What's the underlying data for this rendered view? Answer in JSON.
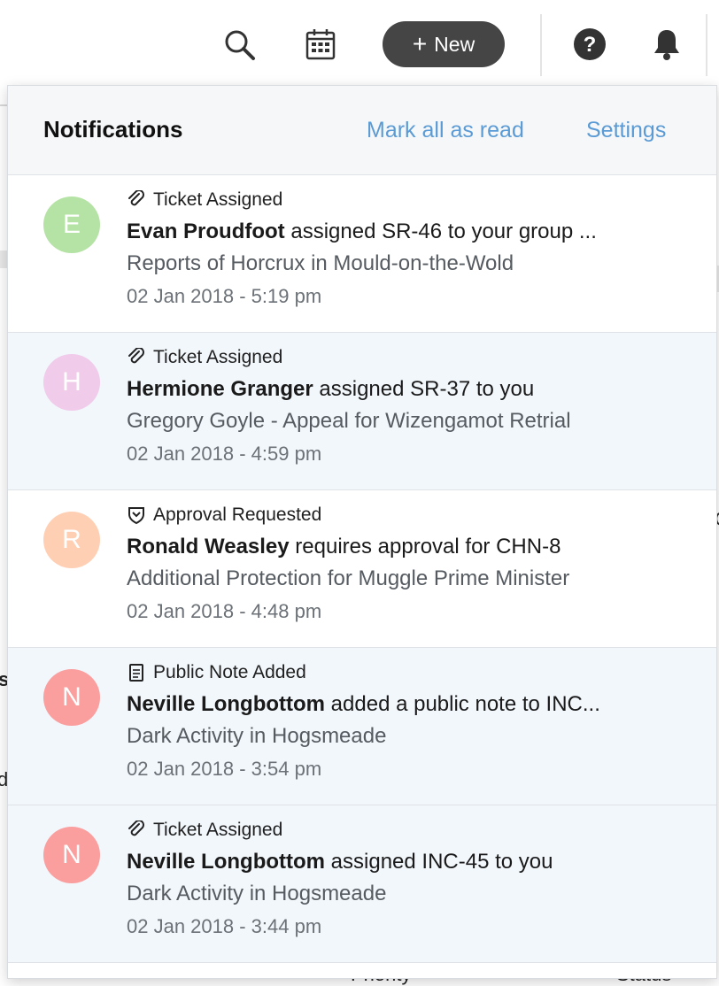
{
  "topbar": {
    "icons": [
      "search-icon",
      "calendar-icon",
      "help-icon",
      "bell-icon"
    ],
    "new_button_label": "New"
  },
  "background": {
    "frag_s": "s",
    "frag_d": "d",
    "frag_c": "C",
    "frag_priority": "Priority",
    "frag_status": "Status"
  },
  "panel": {
    "title": "Notifications",
    "mark_all_read": "Mark all as read",
    "settings": "Settings",
    "accent_link_color": "#5b9bd5"
  },
  "notifications": [
    {
      "type": "Ticket Assigned",
      "type_icon": "paperclip-icon",
      "avatar_letter": "E",
      "avatar_color": "#b5e3a5",
      "actor": "Evan Proudfoot",
      "action": "assigned SR-46 to your group ...",
      "subject": "Reports of Horcrux in Mould-on-the-Wold",
      "time": "02 Jan 2018 - 5:19 pm",
      "unread": false
    },
    {
      "type": "Ticket Assigned",
      "type_icon": "paperclip-icon",
      "avatar_letter": "H",
      "avatar_color": "#f0cbea",
      "actor": "Hermione Granger",
      "action": "assigned SR-37 to you",
      "subject": "Gregory Goyle - Appeal for Wizengamot Retrial",
      "time": "02 Jan 2018 - 4:59 pm",
      "unread": true
    },
    {
      "type": "Approval Requested",
      "type_icon": "approval-shield-icon",
      "avatar_letter": "R",
      "avatar_color": "#ffcfb4",
      "actor": "Ronald Weasley",
      "action": "requires approval for CHN-8",
      "subject": "Additional Protection for Muggle Prime Minister",
      "time": "02 Jan 2018 - 4:48 pm",
      "unread": false
    },
    {
      "type": "Public Note Added",
      "type_icon": "note-icon",
      "avatar_letter": "N",
      "avatar_color": "#fa9e9e",
      "actor": "Neville Longbottom",
      "action": "added a public note to INC...",
      "subject": "Dark Activity in Hogsmeade",
      "time": "02 Jan 2018 - 3:54 pm",
      "unread": true
    },
    {
      "type": "Ticket Assigned",
      "type_icon": "paperclip-icon",
      "avatar_letter": "N",
      "avatar_color": "#fa9e9e",
      "actor": "Neville Longbottom",
      "action": "assigned INC-45 to you",
      "subject": "Dark Activity in Hogsmeade",
      "time": "02 Jan 2018 - 3:44 pm",
      "unread": true
    }
  ]
}
